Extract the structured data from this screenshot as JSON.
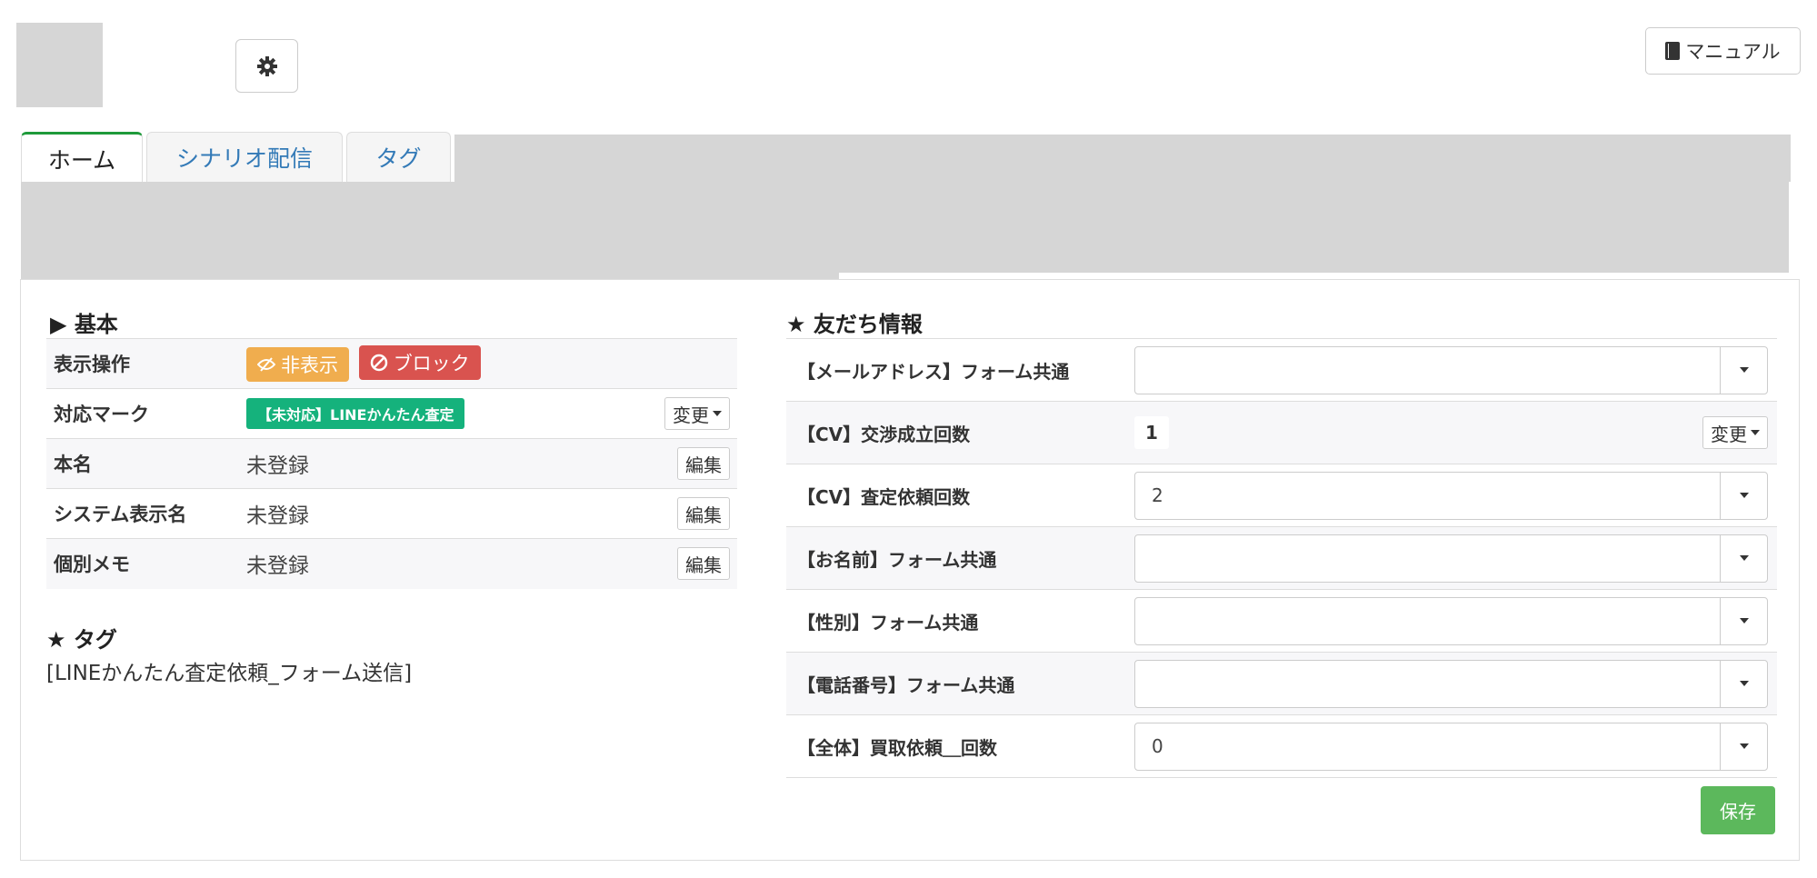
{
  "header": {
    "manual_label": "マニュアル"
  },
  "tabs": [
    {
      "label": "ホーム",
      "active": true
    },
    {
      "label": "シナリオ配信",
      "active": false
    },
    {
      "label": "タグ",
      "active": false
    }
  ],
  "basic": {
    "title": "▶ 基本",
    "rows": [
      {
        "label": "表示操作"
      },
      {
        "label": "対応マーク",
        "mark": "【未対応】LINEかんたん査定",
        "action": "変更"
      },
      {
        "label": "本名",
        "value": "未登録",
        "action": "編集"
      },
      {
        "label": "システム表示名",
        "value": "未登録",
        "action": "編集"
      },
      {
        "label": "個別メモ",
        "value": "未登録",
        "action": "編集"
      }
    ],
    "hide_label": "非表示",
    "block_label": "ブロック"
  },
  "tags": {
    "title": "★ タグ",
    "text": "[LINEかんたん査定依頼_フォーム送信]"
  },
  "friend": {
    "title": "★ 友だち情報",
    "rows": [
      {
        "label": "【メールアドレス】フォーム共通",
        "value": ""
      },
      {
        "label": "【CV】交渉成立回数",
        "value": "1",
        "action": "変更"
      },
      {
        "label": "【CV】査定依頼回数",
        "value": "2"
      },
      {
        "label": "【お名前】フォーム共通",
        "value": ""
      },
      {
        "label": "【性別】フォーム共通",
        "value": ""
      },
      {
        "label": "【電話番号】フォーム共通",
        "value": ""
      },
      {
        "label": "【全体】買取依頼＿回数",
        "value": "0"
      }
    ],
    "save_label": "保存"
  },
  "colors": {
    "tab_active": "#1e9a3a",
    "hide": "#f0ad4e",
    "block": "#d9534f",
    "mark": "#15b27c",
    "save": "#5cb85c",
    "link": "#337ab7"
  }
}
